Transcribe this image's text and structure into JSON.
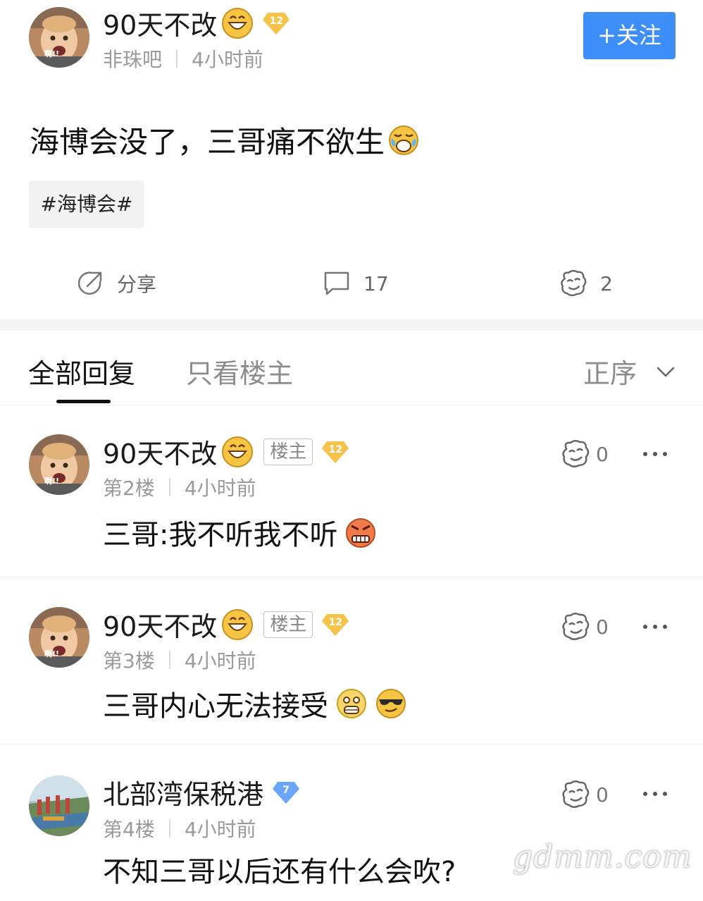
{
  "post": {
    "author": {
      "name": "90天不改",
      "avatar_caption": "啊!!",
      "level": "12"
    },
    "forum": "非珠吧",
    "time": "4小时前",
    "follow_label": "+关注",
    "content": "海博会没了，三哥痛不欲生",
    "topic_tag": "#海博会#",
    "actions": {
      "share_label": "分享",
      "comment_count": "17",
      "like_count": "2"
    }
  },
  "tabs": {
    "all_label": "全部回复",
    "owner_only_label": "只看楼主",
    "sort_label": "正序"
  },
  "replies": [
    {
      "name": "90天不改",
      "avatar_caption": "啊!!",
      "owner_tag": "楼主",
      "level": "12",
      "floor": "第2楼",
      "time": "4小时前",
      "text": "三哥:我不听我不听",
      "likes": "0"
    },
    {
      "name": "90天不改",
      "avatar_caption": "啊!!",
      "owner_tag": "楼主",
      "level": "12",
      "floor": "第3楼",
      "time": "4小时前",
      "text": "三哥内心无法接受",
      "likes": "0"
    },
    {
      "name": "北部湾保税港",
      "level": "7",
      "floor": "第4楼",
      "time": "4小时前",
      "text": "不知三哥以后还有什么会吹?",
      "likes": "0"
    }
  ],
  "watermark": "gdmm.com",
  "icons": {
    "grin": "grinning-face-icon",
    "crying": "crying-face-icon",
    "angry": "angry-face-icon",
    "fearful": "fearful-face-icon",
    "cool": "sunglasses-face-icon",
    "share": "share-icon",
    "comment": "comment-icon",
    "like": "like-icon",
    "more": "more-icon",
    "chevron": "chevron-down-icon"
  },
  "colors": {
    "accent": "#3e8ef7",
    "level_gold": "#f5c24a",
    "level_blue": "#6aa6f8"
  }
}
